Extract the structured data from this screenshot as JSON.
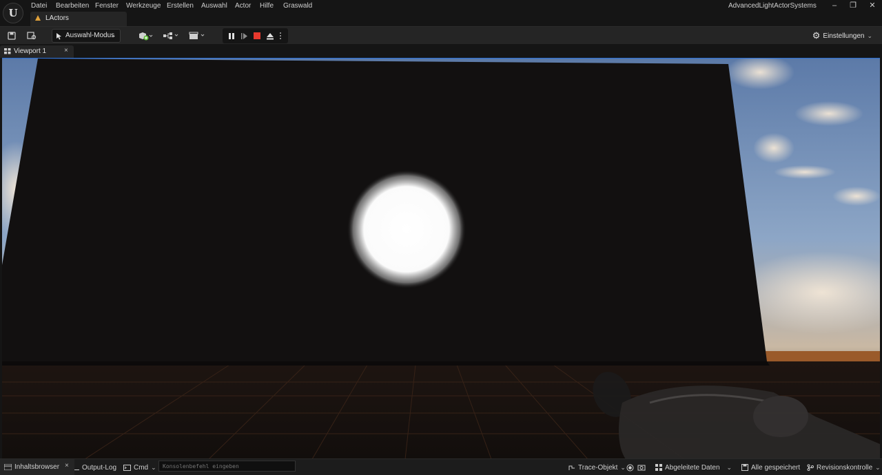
{
  "app": {
    "logo_glyph": "U",
    "menu": [
      "Datei",
      "Bearbeiten",
      "Fenster",
      "Werkzeuge",
      "Erstellen",
      "Auswahl",
      "Actor",
      "Hilfe",
      "Graswald"
    ],
    "document_tab": "LActors",
    "project_name": "AdvancedLightActorSystems",
    "window_buttons": {
      "minimize": "–",
      "maximize": "❐",
      "close": "✕"
    }
  },
  "toolbar": {
    "mode_dropdown": "Auswahl-Modus",
    "settings_label": "Einstellungen",
    "icons": [
      "save-icon",
      "browse-icon",
      "add-actor-icon",
      "blueprint-icon",
      "cinematics-icon",
      "pause-icon",
      "step-icon",
      "stop-icon",
      "eject-icon",
      "more-icon"
    ],
    "colors": {
      "stop": "#e8392e",
      "add": "#5fbf3a",
      "accent": "#2a6fd6"
    }
  },
  "viewport": {
    "tab_label": "Viewport 1",
    "close_glyph": "×"
  },
  "statusbar": {
    "content_browser": "Inhaltsbrowser",
    "close_glyph": "×",
    "output_log": "Output-Log",
    "cmd": "Cmd",
    "console_placeholder": "Konsolenbefehl eingeben",
    "trace": "Trace-Objekt",
    "derived_data": "Abgeleitete Daten",
    "all_saved": "Alle gespeichert",
    "revision": "Revisionskontrolle"
  }
}
